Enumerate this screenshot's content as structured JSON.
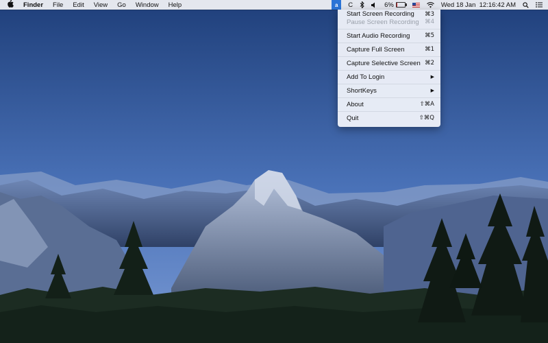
{
  "menubar": {
    "apple_icon": "apple-icon",
    "app_name": "Finder",
    "menus": [
      "File",
      "Edit",
      "View",
      "Go",
      "Window",
      "Help"
    ],
    "status": {
      "app_icon": "screen-recorder-icon",
      "app_icon_glyph": "a",
      "c_label": "C",
      "battery_percent": "6%",
      "battery_level": 0.06,
      "datetime": "Wed 18 Jan  12:16:42 AM"
    }
  },
  "dropdown": {
    "items": [
      {
        "label": "Start Screen Recording",
        "shortcut": "⌘3"
      },
      {
        "label": "Pause Screen Recording",
        "shortcut": "⌘4",
        "disabled": true
      },
      {
        "label": "Start Audio Recording",
        "shortcut": "⌘5"
      },
      {
        "label": "Capture Full Screen",
        "shortcut": "⌘1"
      },
      {
        "label": "Capture Selective Screen",
        "shortcut": "⌘2"
      },
      {
        "label": "Add To Login",
        "submenu": true
      },
      {
        "label": "ShortKeys",
        "submenu": true
      },
      {
        "label": "About",
        "shortcut": "⇧⌘A"
      },
      {
        "label": "Quit",
        "shortcut": "⇧⌘Q"
      }
    ],
    "submenu_arrow": "▶"
  },
  "colors": {
    "sky_top": "#1f3f7a",
    "sky_bottom": "#6b8fcf",
    "accent": "#2b74d6",
    "battery_low": "#d02a2a"
  }
}
